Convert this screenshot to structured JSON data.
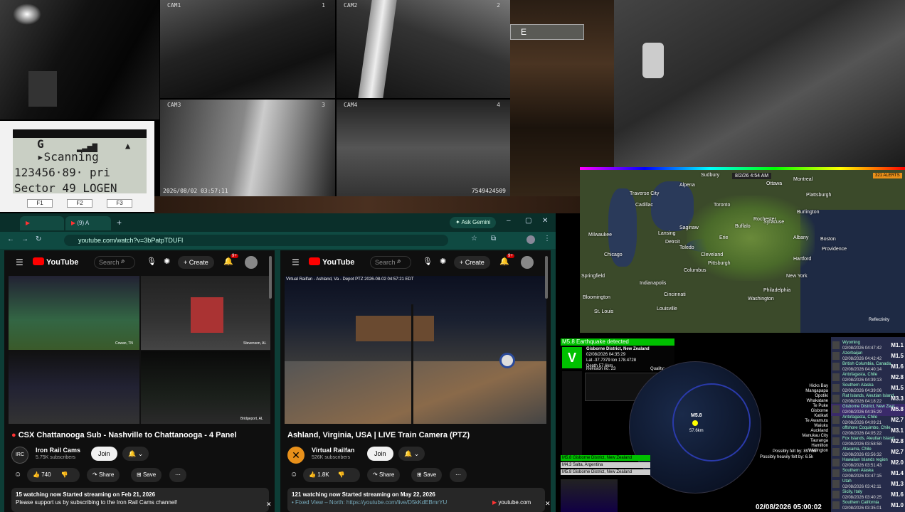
{
  "cameras": {
    "cam1": {
      "label": "CAM1",
      "num": "1"
    },
    "cam2": {
      "label": "CAM2",
      "num": "2"
    },
    "cam3": {
      "label": "CAM3",
      "num": "3"
    },
    "cam4": {
      "label": "CAM4",
      "num": "4"
    },
    "timestamp": "2026/08/02 03:57:11",
    "id": "7549424509",
    "sign_letter": "E"
  },
  "scanner": {
    "line1": "G",
    "line2": "▸Scanning",
    "line3": "123456·89·  pri",
    "line4": "Sector 49 LOGEN",
    "f1": "F1",
    "f2": "F2",
    "f3": "F3"
  },
  "browser": {
    "tab1": "(9) A",
    "gemini": "Ask Gemini",
    "url": "youtube.com/watch?v=3bPatpTDUFI"
  },
  "yt_left": {
    "logo": "YouTube",
    "search": "Search",
    "create": "Create",
    "notif_badge": "9+",
    "title": "CSX Chattanooga Sub - Nashville to Chattanooga - 4 Panel",
    "channel": "Iron Rail Cams",
    "subs": "5.75K subscribers",
    "join": "Join",
    "likes": "740",
    "share": "Share",
    "save": "Save",
    "desc1": "15 watching now  Started streaming on Feb 21, 2026",
    "desc2": "Please support us by subscribing to the Iron Rail Cams channel!",
    "panel_labels": [
      "Cowan, TN",
      "Stevenson, AL",
      "Bridgeport, AL"
    ]
  },
  "yt_right": {
    "logo": "YouTube",
    "search": "Search",
    "create": "Create",
    "notif_badge": "9+",
    "overlay": "Virtual Railfan - Ashland, Va - Depot PTZ   2026-08-02 04:57:21 EDT",
    "title": "Ashland, Virginia, USA | LIVE Train Camera (PTZ)",
    "channel": "Virtual Railfan",
    "subs": "526K subscribers",
    "join": "Join",
    "likes": "1.8K",
    "share": "Share",
    "save": "Save",
    "desc1": "121 watching now  Started streaming on May 22, 2026",
    "desc2": "• Fixed View – North: https://youtube.com/live/D5kKdEBmrYU",
    "domain": "youtube.com"
  },
  "radar": {
    "time": "8/2/26 4:54 AM",
    "alerts": "321 ALERTS",
    "reflectivity": "Reflectivity",
    "cities": [
      {
        "n": "Traverse City"
      },
      {
        "n": "Alpena"
      },
      {
        "n": "Cadillac"
      },
      {
        "n": "Saginaw"
      },
      {
        "n": "Sudbury"
      },
      {
        "n": "Ottawa"
      },
      {
        "n": "Montreal"
      },
      {
        "n": "Plattsburgh"
      },
      {
        "n": "Burlington"
      },
      {
        "n": "Syracuse"
      },
      {
        "n": "Albany"
      },
      {
        "n": "Boston"
      },
      {
        "n": "Providence"
      },
      {
        "n": "Hartford"
      },
      {
        "n": "New York"
      },
      {
        "n": "Philadelphia"
      },
      {
        "n": "Pittsburgh"
      },
      {
        "n": "Cleveland"
      },
      {
        "n": "Detroit"
      },
      {
        "n": "Lansing"
      },
      {
        "n": "Toledo"
      },
      {
        "n": "Columbus"
      },
      {
        "n": "Indianapolis"
      },
      {
        "n": "Cincinnati"
      },
      {
        "n": "Louisville"
      },
      {
        "n": "Chicago"
      },
      {
        "n": "Milwaukee"
      },
      {
        "n": "Springfield"
      },
      {
        "n": "Bloomington"
      },
      {
        "n": "Washington"
      },
      {
        "n": "Buffalo"
      },
      {
        "n": "Toronto"
      },
      {
        "n": "Rochester"
      },
      {
        "n": "Erie"
      },
      {
        "n": "St. Louis"
      }
    ]
  },
  "quake": {
    "alert": "M5.8 Earthquake detected",
    "region": "Gisborne District, New Zealand",
    "datetime": "02/08/2026 04:35:29",
    "latlon": "Lat -37.7379 lon 178.4728",
    "depth": "Depth 57.6km",
    "revision": "Revision no. 23",
    "quality": "Quality:",
    "bar1": "M5.8 Gisborne District, New Zealand",
    "bar2": "M4.3 Salta, Argentina",
    "bar3": "M5.8 Gisborne District, New Zealand",
    "map_mag": "M5.8",
    "map_dist": "57.6km",
    "felt1": "Possibly felt by: 897.5k",
    "felt2": "Possibly heavily felt by: 6.5k",
    "clock": "02/08/2026 05:00:02",
    "towns": [
      "Hicks Bay",
      "Mangapapa",
      "Opotiki",
      "Whakatane",
      "Te Puke",
      "Gisborne",
      "Katikati",
      "Te Awamutu",
      "Waiuku",
      "Auckland",
      "Manukau City",
      "Tauranga",
      "Hamilton",
      "Wellington"
    ]
  },
  "quake_list": [
    {
      "loc": "Wyoming",
      "dt": "02/08/2026 04:47:42",
      "mag": "M1.1"
    },
    {
      "loc": "Azerbaijan",
      "dt": "02/08/2026 04:42:42",
      "mag": "M1.5"
    },
    {
      "loc": "British Columbia, Canada",
      "dt": "02/08/2026 04:40:14",
      "mag": "M1.6"
    },
    {
      "loc": "Antofagasta, Chile",
      "dt": "02/08/2026 04:39:13",
      "mag": "M2.8"
    },
    {
      "loc": "Southern Alaska",
      "dt": "02/08/2026 04:39:06",
      "mag": "M1.5"
    },
    {
      "loc": "Rat Islands, Aleutian Island",
      "dt": "02/08/2026 04:18:22",
      "mag": "M3.3"
    },
    {
      "loc": "Gisborne District, New Zeal.",
      "dt": "02/08/2026 04:35:29",
      "mag": "M5.8"
    },
    {
      "loc": "Antofagasta, Chile",
      "dt": "02/08/2026 04:09:21",
      "mag": "M2.7"
    },
    {
      "loc": "offshore Coquimbo, Chile",
      "dt": "02/08/2026 04:05:22",
      "mag": "M3.1"
    },
    {
      "loc": "Fox Islands, Aleutian Island",
      "dt": "02/08/2026 03:58:58",
      "mag": "M2.8"
    },
    {
      "loc": "Atacama, Chile",
      "dt": "02/08/2026 03:56:32",
      "mag": "M2.7"
    },
    {
      "loc": "Hawaiian Islands region",
      "dt": "02/08/2026 03:51:43",
      "mag": "M2.0"
    },
    {
      "loc": "Southern Alaska",
      "dt": "02/08/2026 03:47:15",
      "mag": "M1.4"
    },
    {
      "loc": "Utah",
      "dt": "02/08/2026 03:42:11",
      "mag": "M1.3"
    },
    {
      "loc": "Sicily, Italy",
      "dt": "02/08/2026 03:40:25",
      "mag": "M1.6"
    },
    {
      "loc": "Southern California",
      "dt": "02/08/2026 03:35:01",
      "mag": "M1.0"
    }
  ],
  "colors": {
    "yt_red": "#ff0000",
    "browser_teal": "#0d3d36",
    "quake_green": "#00c000",
    "mag_yellow": "#ffff00"
  }
}
